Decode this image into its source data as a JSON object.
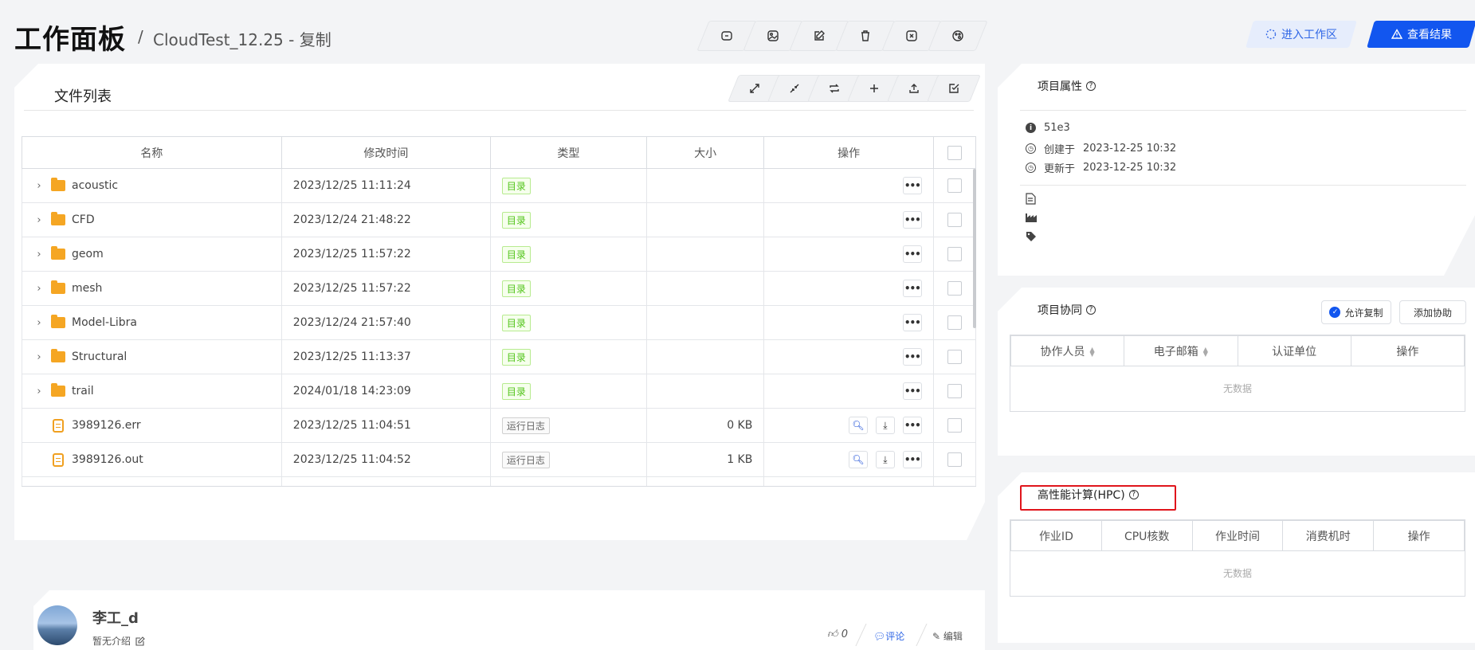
{
  "header": {
    "title": "工作面板",
    "separator": "/",
    "project_name": "CloudTest_12.25 - 复制",
    "toolbar_icons": [
      "copy-icon",
      "image-icon",
      "edit-icon",
      "delete-icon",
      "close-icon",
      "palette-icon"
    ],
    "enter_workspace": "进入工作区",
    "view_results": "查看结果"
  },
  "file_panel": {
    "title": "文件列表",
    "tool_icons": [
      "expand-icon",
      "collapse-icon",
      "refresh-icon",
      "add-icon",
      "upload-icon",
      "select-icon"
    ],
    "columns": [
      "名称",
      "修改时间",
      "类型",
      "大小",
      "操作"
    ],
    "rows": [
      {
        "name": "acoustic",
        "time": "2023/12/25 11:11:24",
        "type": "目录",
        "size": "",
        "kind": "folder"
      },
      {
        "name": "CFD",
        "time": "2023/12/24 21:48:22",
        "type": "目录",
        "size": "",
        "kind": "folder"
      },
      {
        "name": "geom",
        "time": "2023/12/25 11:57:22",
        "type": "目录",
        "size": "",
        "kind": "folder"
      },
      {
        "name": "mesh",
        "time": "2023/12/25 11:57:22",
        "type": "目录",
        "size": "",
        "kind": "folder"
      },
      {
        "name": "Model-Libra",
        "time": "2023/12/24 21:57:40",
        "type": "目录",
        "size": "",
        "kind": "folder"
      },
      {
        "name": "Structural",
        "time": "2023/12/25 11:13:37",
        "type": "目录",
        "size": "",
        "kind": "folder"
      },
      {
        "name": "trail",
        "time": "2024/01/18 14:23:09",
        "type": "目录",
        "size": "",
        "kind": "folder"
      },
      {
        "name": "3989126.err",
        "time": "2023/12/25 11:04:51",
        "type": "运行日志",
        "size": "0 KB",
        "kind": "file"
      },
      {
        "name": "3989126.out",
        "time": "2023/12/25 11:04:52",
        "type": "运行日志",
        "size": "1 KB",
        "kind": "file"
      }
    ]
  },
  "project_props": {
    "title": "项目属性",
    "id": "51e3",
    "created_label": "创建于",
    "created": "2023-12-25 10:32",
    "updated_label": "更新于",
    "updated": "2023-12-25 10:32"
  },
  "collab": {
    "title": "项目协同",
    "allow_copy": "允许复制",
    "add_collab": "添加协助",
    "columns": [
      "协作人员",
      "电子邮箱",
      "认证单位",
      "操作"
    ],
    "empty": "无数据"
  },
  "hpc": {
    "title": "高性能计算(HPC)",
    "columns": [
      "作业ID",
      "CPU核数",
      "作业时间",
      "消费机时",
      "操作"
    ],
    "empty": "无数据"
  },
  "profile": {
    "name": "李工_d",
    "intro": "暂无介绍",
    "likes": "0",
    "comment": "评论",
    "edit": "编辑"
  },
  "colors": {
    "primary": "#1256ef",
    "highlight": "#e0151c",
    "folder": "#f5a623",
    "tag_green": "#52c41a"
  }
}
